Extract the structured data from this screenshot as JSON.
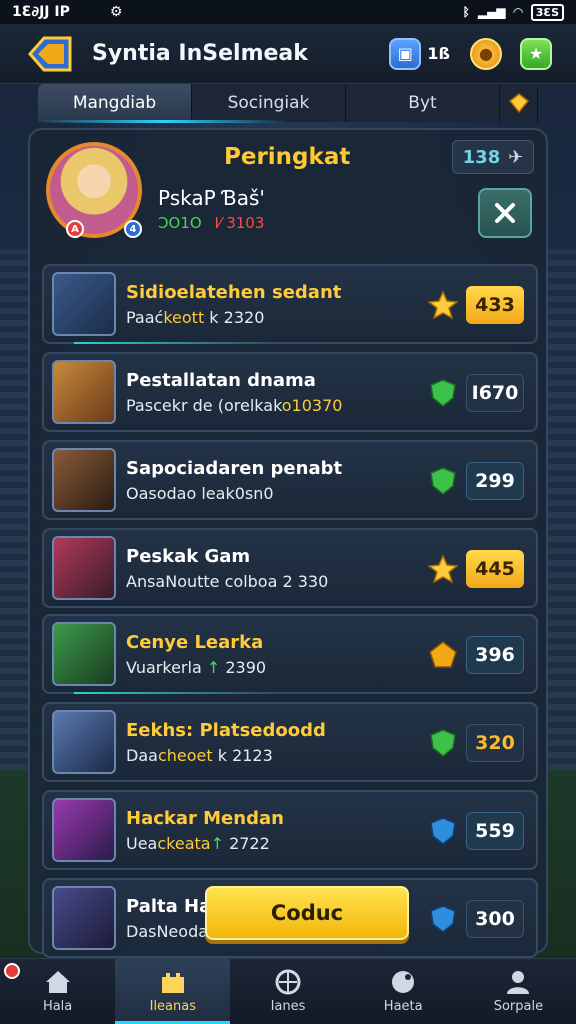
{
  "status_bar": {
    "time": "1Ɛ∂JJ IP",
    "carrier_icon": "sim-icon",
    "battery_text": "3ƐS"
  },
  "header": {
    "title": "Syntia InSelmeak",
    "currency_count": "1ß"
  },
  "tabs": [
    {
      "label": "Mangdiab",
      "active": true
    },
    {
      "label": "Socingiak",
      "active": false
    },
    {
      "label": "Byt",
      "active": false
    }
  ],
  "profile": {
    "rank_title": "Peringkat",
    "name": "PskaP Ɓaš'",
    "stat_green": "ƆO1O",
    "stat_red": "I⁄ 3103",
    "rank_number": "138"
  },
  "rows": [
    {
      "name": "Sidioelatehen sedant",
      "name_color": "gold",
      "sub_prefix": "Paać",
      "sub_hl": "keott",
      "sub_suffix": " k 2320",
      "score": "433",
      "score_style": "gold",
      "rank_icon": "star-icon"
    },
    {
      "name": "Pestallatan dnama",
      "name_color": "white",
      "sub_prefix": "Pascekr de  (orelkak",
      "sub_hl": "o10370",
      "sub_suffix": "",
      "score": "I670",
      "score_style": "dark",
      "rank_icon": "shield-green-icon"
    },
    {
      "name": "Sapociadaren penabt",
      "name_color": "white",
      "sub_prefix": "Oasodao  leak0sn0",
      "sub_hl": "",
      "sub_suffix": "",
      "score": "299",
      "score_style": "teal",
      "rank_icon": "shield-green-icon"
    },
    {
      "name": "Peskak Gam",
      "name_color": "white",
      "sub_prefix": "AnsaNoutte colboa 2 330",
      "sub_hl": "",
      "sub_suffix": "",
      "score": "445",
      "score_style": "gold",
      "rank_icon": "star-icon"
    },
    {
      "name": "Cenye Learka",
      "name_color": "gold",
      "sub_prefix": "Vuarkerla ",
      "sub_hl": "",
      "sub_grn": "↑",
      "sub_suffix": " 2390",
      "score": "396",
      "score_style": "teal",
      "rank_icon": "shield-gold-icon"
    },
    {
      "name": "Eekhs: Platsedoodd",
      "name_color": "gold-white",
      "sub_prefix": "Daa",
      "sub_hl": "cheoet",
      "sub_suffix": " k 2123",
      "score": "320",
      "score_style": "amber-dark",
      "rank_icon": "shield-green-icon"
    },
    {
      "name": "Hackar Mendan",
      "name_color": "gold-white",
      "sub_prefix": "Uea",
      "sub_hl": "ckeata",
      "sub_grn": "↑",
      "sub_suffix": " 2722",
      "score": "559",
      "score_style": "teal",
      "rank_icon": "shield-blue-icon"
    },
    {
      "name": "Palta Hal",
      "name_color": "white",
      "sub_prefix": "DasNeoda",
      "sub_hl": "",
      "sub_suffix": "",
      "score": "300",
      "score_style": "dark",
      "rank_icon": "shield-blue-icon"
    }
  ],
  "cta": {
    "label": "Coduc"
  },
  "bottom_nav": [
    {
      "label": "Hala",
      "icon": "home-icon",
      "active": false,
      "notif": true
    },
    {
      "label": "Ileanas",
      "icon": "castle-icon",
      "active": true,
      "notif": false
    },
    {
      "label": "Ianes",
      "icon": "globe-icon",
      "active": false,
      "notif": false
    },
    {
      "label": "Haeta",
      "icon": "controller-icon",
      "active": false,
      "notif": false
    },
    {
      "label": "Sorpale",
      "icon": "profile-icon",
      "active": false,
      "notif": false
    }
  ],
  "colors": {
    "accent_gold": "#ffc933",
    "accent_cyan": "#2bd4ff",
    "panel_bg": "#1a2636"
  }
}
